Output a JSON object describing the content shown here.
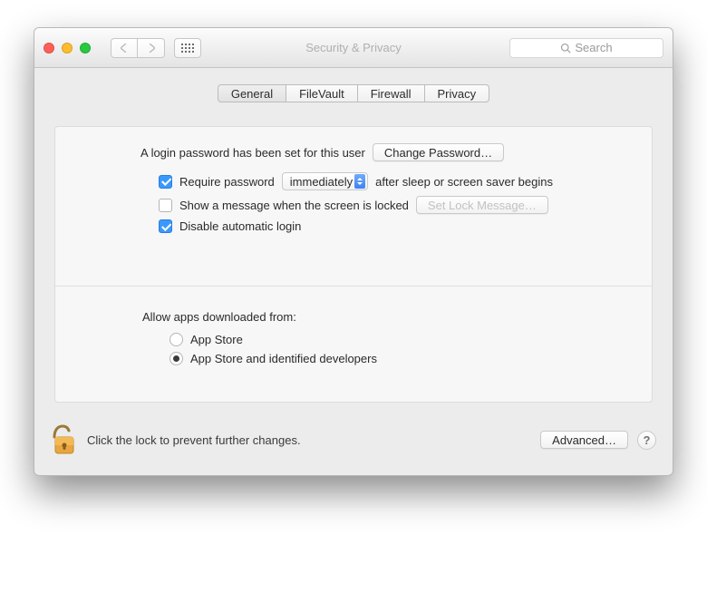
{
  "header": {
    "title": "Security & Privacy",
    "search_placeholder": "Search"
  },
  "tabs": {
    "general": "General",
    "filevault": "FileVault",
    "firewall": "Firewall",
    "privacy": "Privacy"
  },
  "panel": {
    "pw_set_label": "A login password has been set for this user",
    "change_pw_label": "Change Password…",
    "require_pw_label": "Require password",
    "require_pw_select": "immediately",
    "require_pw_suffix": "after sleep or screen saver begins",
    "show_msg_label": "Show a message when the screen is locked",
    "set_lock_msg_label": "Set Lock Message…",
    "disable_auto_login_label": "Disable automatic login",
    "allow_apps_label": "Allow apps downloaded from:",
    "radio_appstore": "App Store",
    "radio_identified": "App Store and identified developers"
  },
  "footer": {
    "hint": "Click the lock to prevent further changes.",
    "advanced_label": "Advanced…"
  }
}
